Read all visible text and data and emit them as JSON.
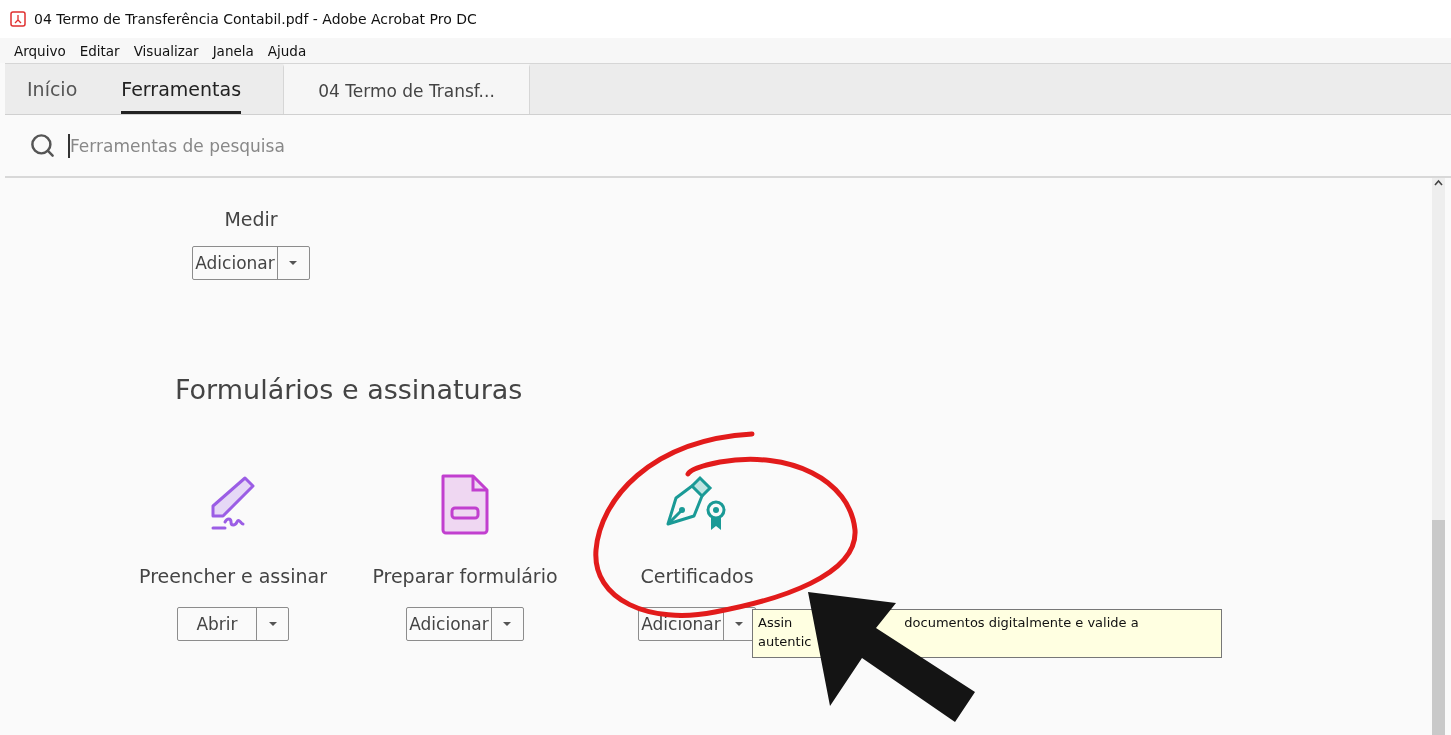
{
  "window": {
    "title": "04 Termo de Transferência Contabil.pdf - Adobe Acrobat Pro DC"
  },
  "menu": [
    "Arquivo",
    "Editar",
    "Visualizar",
    "Janela",
    "Ajuda"
  ],
  "tabs": [
    {
      "label": "Início",
      "selected": false,
      "kind": "nav"
    },
    {
      "label": "Ferramentas",
      "selected": true,
      "kind": "nav"
    },
    {
      "label": "04 Termo de Transf...",
      "selected": false,
      "kind": "document"
    }
  ],
  "search": {
    "placeholder": "Ferramentas de pesquisa"
  },
  "measure_tool": {
    "label": "Medir",
    "button": "Adicionar"
  },
  "section": {
    "title": "Formulários e assinaturas",
    "tools": [
      {
        "kind": "sign",
        "label": "Preencher e assinar",
        "button": "Abrir"
      },
      {
        "kind": "form",
        "label": "Preparar formulário",
        "button": "Adicionar"
      },
      {
        "kind": "certificate",
        "label": "Certificados",
        "button": "Adicionar"
      }
    ]
  },
  "tooltip": {
    "lines": [
      [
        "Assin",
        "documentos digitalmente e valide a"
      ],
      [
        "autentic"
      ]
    ]
  }
}
